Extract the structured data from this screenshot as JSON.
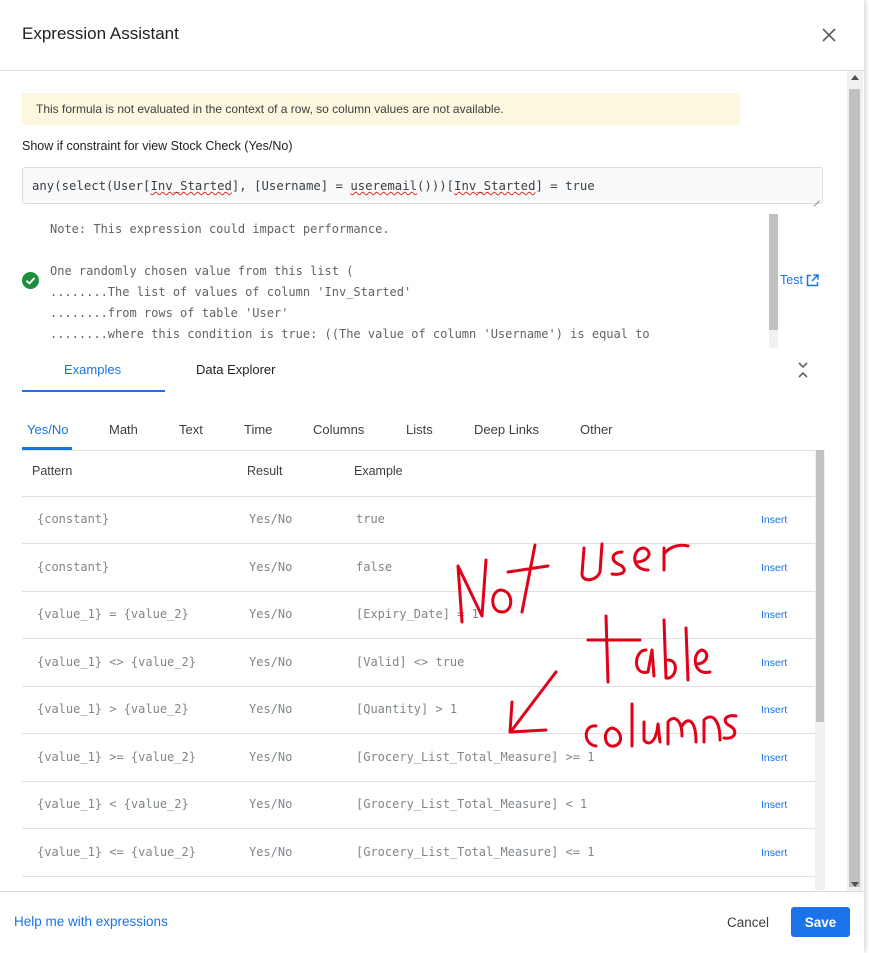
{
  "dialog": {
    "title": "Expression Assistant",
    "close_icon": "close-icon"
  },
  "warning": "This formula is not evaluated in the context of a row, so column values are not available.",
  "constraint_label": "Show if constraint for view Stock Check (Yes/No)",
  "expression": {
    "part1": "any(select(User[",
    "part2": "Inv_Started",
    "part3": "], [Username] = ",
    "part4": "useremail",
    "part5": "()))[",
    "part6": "Inv_Started",
    "part7": "] = true"
  },
  "output_lines": [
    "Note: This expression could impact performance.",
    "",
    "One randomly chosen value from this list (",
    "........The list of values of column 'Inv_Started'",
    "........from rows of table 'User'",
    "........where this condition is true: ((The value of column 'Username') is equal to"
  ],
  "test_label": "Test",
  "main_tabs": [
    {
      "label": "Examples",
      "active": true
    },
    {
      "label": "Data Explorer",
      "active": false
    }
  ],
  "sub_tabs": [
    {
      "label": "Yes/No",
      "active": true
    },
    {
      "label": "Math"
    },
    {
      "label": "Text"
    },
    {
      "label": "Time"
    },
    {
      "label": "Columns"
    },
    {
      "label": "Lists"
    },
    {
      "label": "Deep Links"
    },
    {
      "label": "Other"
    }
  ],
  "table": {
    "headers": [
      "Pattern",
      "Result",
      "Example"
    ],
    "insert_label": "Insert",
    "rows": [
      {
        "pattern": "{constant}",
        "result": "Yes/No",
        "example": "true"
      },
      {
        "pattern": "{constant}",
        "result": "Yes/No",
        "example": "false"
      },
      {
        "pattern": "{value_1} = {value_2}",
        "result": "Yes/No",
        "example": "[Expiry_Date] = 1"
      },
      {
        "pattern": "{value_1} <> {value_2}",
        "result": "Yes/No",
        "example": "[Valid] <> true"
      },
      {
        "pattern": "{value_1} > {value_2}",
        "result": "Yes/No",
        "example": "[Quantity] > 1"
      },
      {
        "pattern": "{value_1} >= {value_2}",
        "result": "Yes/No",
        "example": "[Grocery_List_Total_Measure] >= 1"
      },
      {
        "pattern": "{value_1} < {value_2}",
        "result": "Yes/No",
        "example": "[Grocery_List_Total_Measure] < 1"
      },
      {
        "pattern": "{value_1} <= {value_2}",
        "result": "Yes/No",
        "example": "[Grocery_List_Total_Measure] <= 1"
      }
    ]
  },
  "footer": {
    "help_label": "Help me with expressions",
    "cancel_label": "Cancel",
    "save_label": "Save"
  },
  "colors": {
    "accent": "#1a73e8",
    "warning_bg": "#fef7e0",
    "success": "#1e8e3e",
    "annotation": "#e0001a"
  }
}
